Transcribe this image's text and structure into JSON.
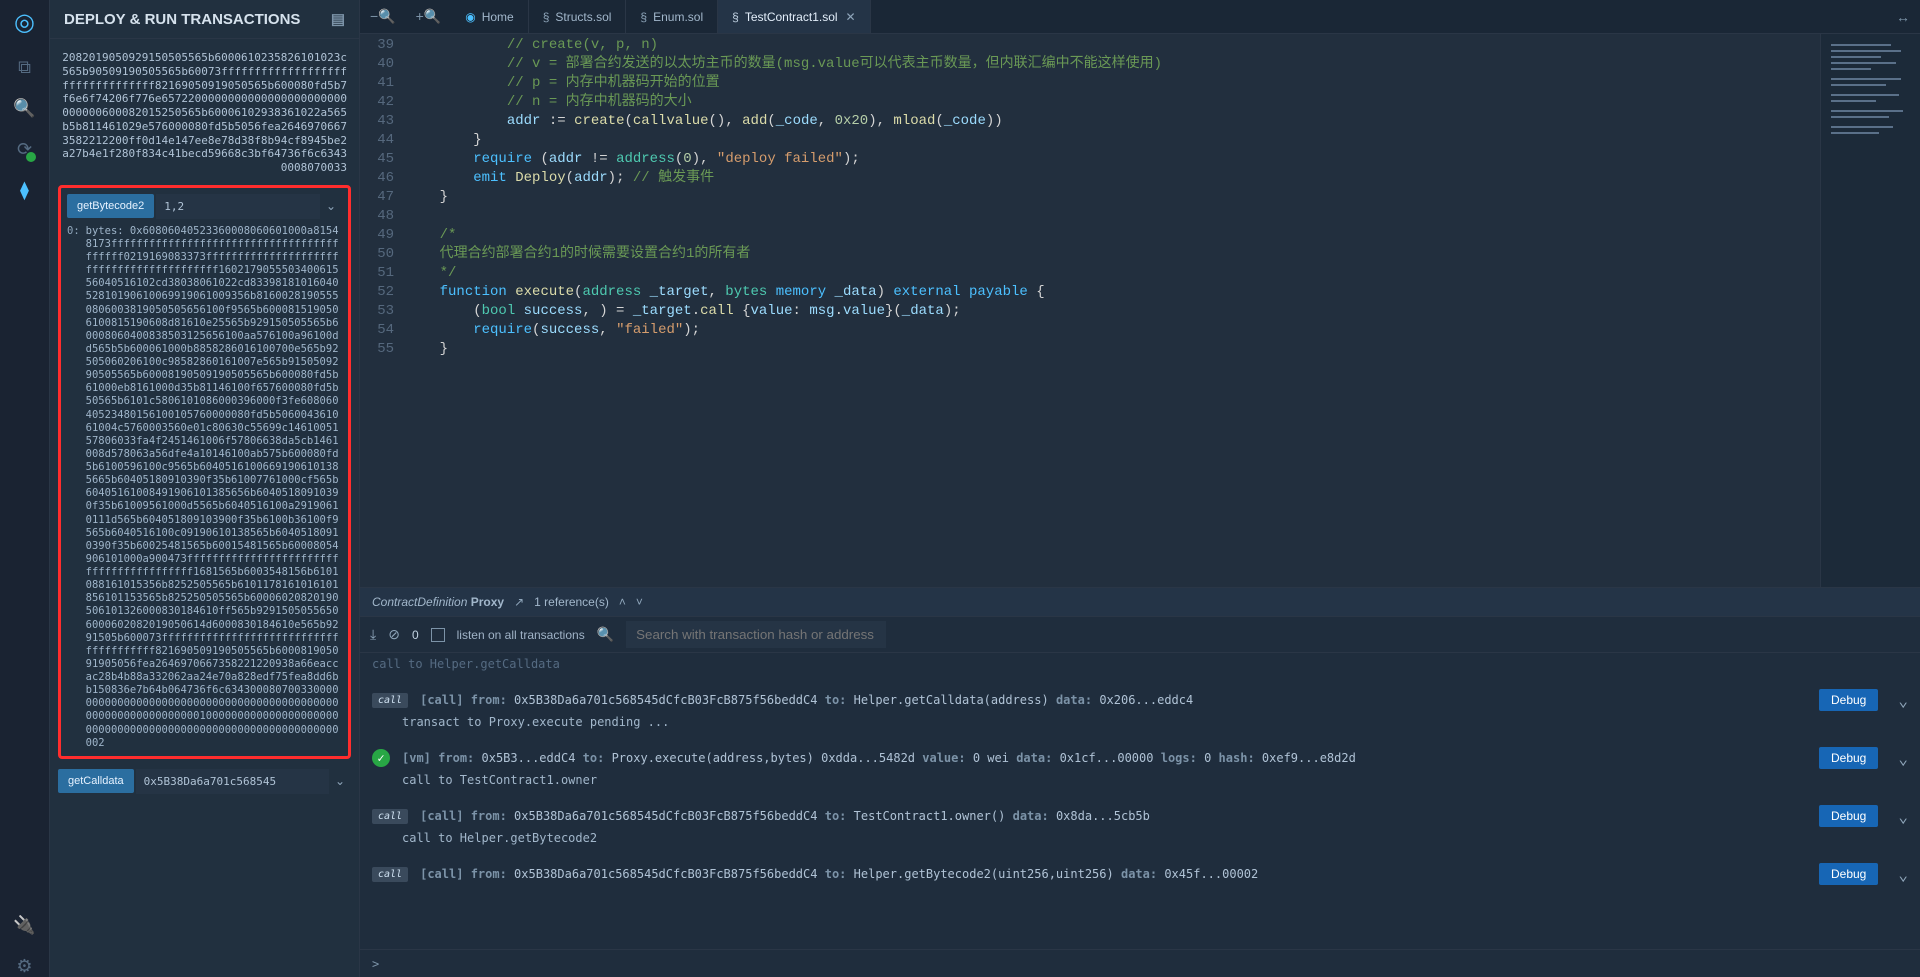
{
  "sidePanel": {
    "title": "DEPLOY & RUN TRANSACTIONS",
    "topBlob": "2082019050929150505565b6000610235826101023c565b90509190505565b60073fffffffffffffffffffffffffffffffff82169050919050565b600080fd5b7f6e6f74206f776e6572200000000000000000000000000000600082015250565b60006102938361022a565b5b811461029e576000080fd5b5056fea26469706673582212200ff0d14e147ee8e78d38f8b94cf8945be2a27b4e1f280f834c41becd59668c3bf64736f6c63430008070033",
    "funcs": [
      {
        "name": "getBytecode2",
        "input": "1,2"
      },
      {
        "name": "getCalldata",
        "input": "0x5B38Da6a701c568545"
      }
    ],
    "output_prefix": "0:",
    "output_label": "bytes: ",
    "output": "0x60806040523360008060601000a81548173ffffffffffffffffffffffffffffffffffffffffff0219169083373ffffffffffffffffffffffffffffffffffffffffff160217905550340061556040516102cd38038061022cd8339818101604052810190610069919061009356b81600281905550806003819050505656100f9565b6000815190506100815190608d81610e25565b929150505565b60008060400838503125656100aa576100a96100dd565b5b600061000b8858286016100700e565b92505060206100c98582860161007e565b9150509290505565b60008190509190505565b600080fd5b61000eb8161000d35b81146100f657600080fd5b50565b6101c5806101086000396000f3fe60806040523480156100105760000080fd5b506004361061004c5760003560e01c80630c55699c1461005157806033fa4f2451461006f57806638da5cb1461008d578063a56dfe4a10146100ab575b600080fd5b6100596100c9565b60405161006691906101385665b60405180910390f35b61007761000cf565b60405161008491906101385656b60405180910390f35b61009561000d5565b6040516100a29190610111d565b604051809103900f35b6100b36100f9565b6040516100c09190610138565b60405180910390f35b60025481565b60015481565b60008054906101000a900473fffffffffffffffffffffffffffffffffffffffff1681565b6003548156b6101088161015356b8252505565b6101178161016101856101153565b825250505565b60006020820190506101326000830184610ff565b92915050556506000602082019050614d6000830184610e565b9291505b600073fffffffffffffffffffffffffffffffffffffff821690509190505565b600081905091905056fea2646970667358221220938a66eaccac28b4b88a332062aa24e70a828edf75fea8dd6bb150836e7b64b064736f6c634300080700330000000000000000000000000000000000000000000000000000000000000010000000000000000000000000000000000000000000000000000000000000002"
  },
  "tabs": [
    {
      "label": "Home",
      "icon": "home",
      "active": false
    },
    {
      "label": "Structs.sol",
      "icon": "sol",
      "active": false
    },
    {
      "label": "Enum.sol",
      "icon": "sol",
      "active": false
    },
    {
      "label": "TestContract1.sol",
      "icon": "sol",
      "active": true
    }
  ],
  "editor": {
    "lines": [
      {
        "n": 39,
        "html": "            <span class='c-comment'>// create(v, p, n)</span>"
      },
      {
        "n": 40,
        "html": "            <span class='c-comment'>// v = 部署合约发送的以太坊主币的数量(msg.value可以代表主币数量，但内联汇编中不能这样使用)</span>"
      },
      {
        "n": 41,
        "html": "            <span class='c-comment'>// p = 内存中机器码开始的位置</span>"
      },
      {
        "n": 42,
        "html": "            <span class='c-comment'>// n = 内存中机器码的大小</span>"
      },
      {
        "n": 43,
        "html": "            <span class='c-ident'>addr</span> <span class='c-punc'>:=</span> <span class='c-fn'>create</span><span class='c-punc'>(</span><span class='c-fn'>callvalue</span><span class='c-punc'>(),</span> <span class='c-fn'>add</span><span class='c-punc'>(</span><span class='c-ident'>_code</span><span class='c-punc'>,</span> <span class='c-num'>0x20</span><span class='c-punc'>),</span> <span class='c-fn'>mload</span><span class='c-punc'>(</span><span class='c-ident'>_code</span><span class='c-punc'>))</span>"
      },
      {
        "n": 44,
        "html": "        <span class='c-punc'>}</span>"
      },
      {
        "n": 45,
        "html": "        <span class='c-kw'>require</span> <span class='c-punc'>(</span><span class='c-ident'>addr</span> <span class='c-punc'>!=</span> <span class='c-type'>address</span><span class='c-punc'>(</span><span class='c-num'>0</span><span class='c-punc'>),</span> <span class='c-str'>\"deploy failed\"</span><span class='c-punc'>);</span>"
      },
      {
        "n": 46,
        "html": "        <span class='c-kw'>emit</span> <span class='c-fn'>Deploy</span><span class='c-punc'>(</span><span class='c-ident'>addr</span><span class='c-punc'>);</span> <span class='c-comment'>// 触发事件</span>"
      },
      {
        "n": 47,
        "html": "    <span class='c-punc'>}</span>"
      },
      {
        "n": 48,
        "html": ""
      },
      {
        "n": 49,
        "html": "    <span class='c-comment'>/*</span>"
      },
      {
        "n": 50,
        "html": "    <span class='c-comment'>代理合约部署合约1的时候需要设置合约1的所有者</span>"
      },
      {
        "n": 51,
        "html": "    <span class='c-comment'>*/</span>"
      },
      {
        "n": 52,
        "html": "    <span class='c-kw'>function</span> <span class='c-fn'>execute</span><span class='c-punc'>(</span><span class='c-type'>address</span> <span class='c-ident'>_target</span><span class='c-punc'>,</span> <span class='c-type'>bytes</span> <span class='c-kw'>memory</span> <span class='c-ident'>_data</span><span class='c-punc'>)</span> <span class='c-kw'>external</span> <span class='c-kw'>payable</span> <span class='c-punc'>{</span>"
      },
      {
        "n": 53,
        "html": "        <span class='c-punc'>(</span><span class='c-type'>bool</span> <span class='c-ident'>success</span><span class='c-punc'>, ) =</span> <span class='c-ident'>_target</span><span class='c-punc'>.</span><span class='c-fn'>call</span> <span class='c-punc'>{</span><span class='c-ident'>value</span><span class='c-punc'>:</span> <span class='c-ident'>msg</span><span class='c-punc'>.</span><span class='c-ident'>value</span><span class='c-punc'>}(</span><span class='c-ident'>_data</span><span class='c-punc'>);</span>"
      },
      {
        "n": 54,
        "html": "        <span class='c-kw'>require</span><span class='c-punc'>(</span><span class='c-ident'>success</span><span class='c-punc'>,</span> <span class='c-str'>\"failed\"</span><span class='c-punc'>);</span>"
      },
      {
        "n": 55,
        "html": "    <span class='c-punc'>}</span>"
      }
    ]
  },
  "refBar": {
    "prefix": "ContractDefinition",
    "name": "Proxy",
    "count": "1 reference(s)"
  },
  "terminal": {
    "count": "0",
    "listenLabel": "listen on all transactions",
    "searchPlaceholder": "Search with transaction hash or address",
    "firstLine": "call to Helper.getCalldata",
    "logs": [
      {
        "type": "call",
        "icon": "call",
        "segments": [
          {
            "k": "[call]",
            "c": "log-kw"
          },
          {
            "k": "from:",
            "c": "log-kw"
          },
          {
            "k": "0x5B38Da6a701c568545dCfcB03FcB875f56beddC4",
            "c": "log-val"
          },
          {
            "k": "to:",
            "c": "log-kw"
          },
          {
            "k": "Helper.getCalldata(address)",
            "c": "log-val"
          },
          {
            "k": "data:",
            "c": "log-kw"
          },
          {
            "k": "0x206...eddc4",
            "c": "log-val"
          }
        ],
        "sub": "transact to Proxy.execute pending ...",
        "debug": "Debug"
      },
      {
        "type": "vm",
        "icon": "success",
        "segments": [
          {
            "k": "[vm]",
            "c": "log-kw"
          },
          {
            "k": "from:",
            "c": "log-kw"
          },
          {
            "k": "0x5B3...eddC4",
            "c": "log-val"
          },
          {
            "k": "to:",
            "c": "log-kw"
          },
          {
            "k": "Proxy.execute(address,bytes) 0xdda...5482d",
            "c": "log-val"
          },
          {
            "k": "value:",
            "c": "log-kw"
          },
          {
            "k": "0 wei",
            "c": "log-val"
          },
          {
            "k": "data:",
            "c": "log-kw"
          },
          {
            "k": "0x1cf...00000",
            "c": "log-val"
          },
          {
            "k": "logs:",
            "c": "log-kw"
          },
          {
            "k": "0",
            "c": "log-val"
          },
          {
            "k": "hash:",
            "c": "log-kw"
          },
          {
            "k": "0xef9...e8d2d",
            "c": "log-val"
          }
        ],
        "sub": "call to TestContract1.owner",
        "debug": "Debug"
      },
      {
        "type": "call",
        "icon": "call",
        "segments": [
          {
            "k": "[call]",
            "c": "log-kw"
          },
          {
            "k": "from:",
            "c": "log-kw"
          },
          {
            "k": "0x5B38Da6a701c568545dCfcB03FcB875f56beddC4",
            "c": "log-val"
          },
          {
            "k": "to:",
            "c": "log-kw"
          },
          {
            "k": "TestContract1.owner()",
            "c": "log-val"
          },
          {
            "k": "data:",
            "c": "log-kw"
          },
          {
            "k": "0x8da...5cb5b",
            "c": "log-val"
          }
        ],
        "sub": "call to Helper.getBytecode2",
        "debug": "Debug"
      },
      {
        "type": "call",
        "icon": "call",
        "segments": [
          {
            "k": "[call]",
            "c": "log-kw"
          },
          {
            "k": "from:",
            "c": "log-kw"
          },
          {
            "k": "0x5B38Da6a701c568545dCfcB03FcB875f56beddC4",
            "c": "log-val"
          },
          {
            "k": "to:",
            "c": "log-kw"
          },
          {
            "k": "Helper.getBytecode2(uint256,uint256)",
            "c": "log-val"
          },
          {
            "k": "data:",
            "c": "log-kw"
          },
          {
            "k": "0x45f...00002",
            "c": "log-val"
          }
        ],
        "sub": "",
        "debug": "Debug"
      }
    ],
    "prompt": ">"
  }
}
